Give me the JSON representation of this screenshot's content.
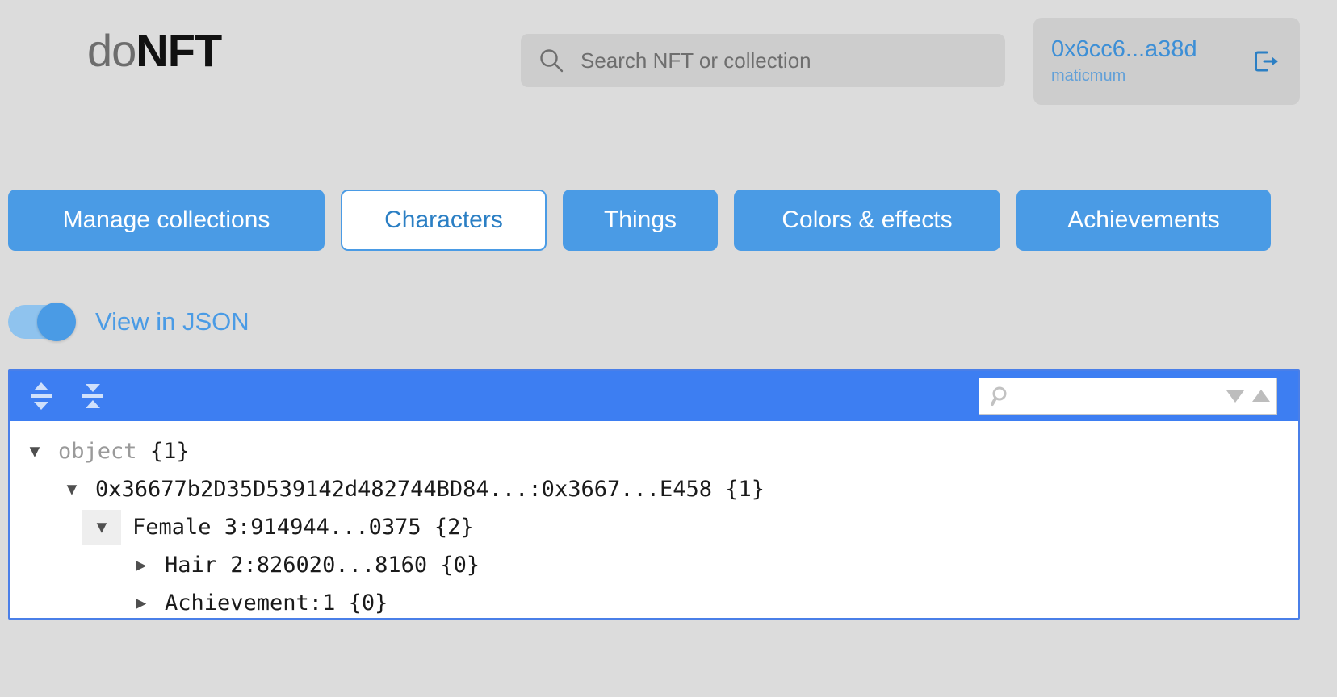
{
  "header": {
    "logo_light": "do",
    "logo_bold": "NFT",
    "search": {
      "icon": "search-icon",
      "placeholder": "Search NFT or collection",
      "value": ""
    },
    "wallet": {
      "address": "0x6cc6...a38d",
      "network": "maticmum",
      "logout_icon": "logout-icon"
    }
  },
  "tabs": [
    {
      "label": "Manage collections",
      "active": false
    },
    {
      "label": "Characters",
      "active": true
    },
    {
      "label": "Things",
      "active": false
    },
    {
      "label": "Colors & effects",
      "active": false
    },
    {
      "label": "Achievements",
      "active": false
    }
  ],
  "view_toggle": {
    "label": "View in JSON",
    "state": "on"
  },
  "json_viewer": {
    "toolbar": {
      "expand_all_icon": "expand-all-icon",
      "collapse_all_icon": "collapse-all-icon",
      "search_icon": "search-icon",
      "search_value": "",
      "search_placeholder": "",
      "next_match_icon": "triangle-down-icon",
      "prev_match_icon": "triangle-up-icon"
    },
    "rows": [
      {
        "indent": 0,
        "caret": "▼",
        "caret_boxed": false,
        "key": "object",
        "key_style": "gray",
        "count": "{1}"
      },
      {
        "indent": 1,
        "caret": "▼",
        "caret_boxed": false,
        "key": "0x36677b2D35D539142d482744BD84...:0x3667...E458",
        "key_style": "dark",
        "count": "{1}"
      },
      {
        "indent": 2,
        "caret": "▼",
        "caret_boxed": true,
        "key": "Female 3:914944...0375",
        "key_style": "dark",
        "count": "{2}"
      },
      {
        "indent": 3,
        "caret": "▶",
        "caret_boxed": false,
        "key": "Hair 2:826020...8160",
        "key_style": "dark",
        "count": "{0}"
      },
      {
        "indent": 3,
        "caret": "▶",
        "caret_boxed": false,
        "key": "Achievement:1",
        "key_style": "dark",
        "count": "{0}"
      }
    ]
  },
  "colors": {
    "page_background": "#dcdcdc",
    "accent_blue": "#4a9be5",
    "toolbar_blue": "#3d7ef2",
    "wallet_blue": "#3d8fd6",
    "field_gray": "#cdcdcd"
  }
}
